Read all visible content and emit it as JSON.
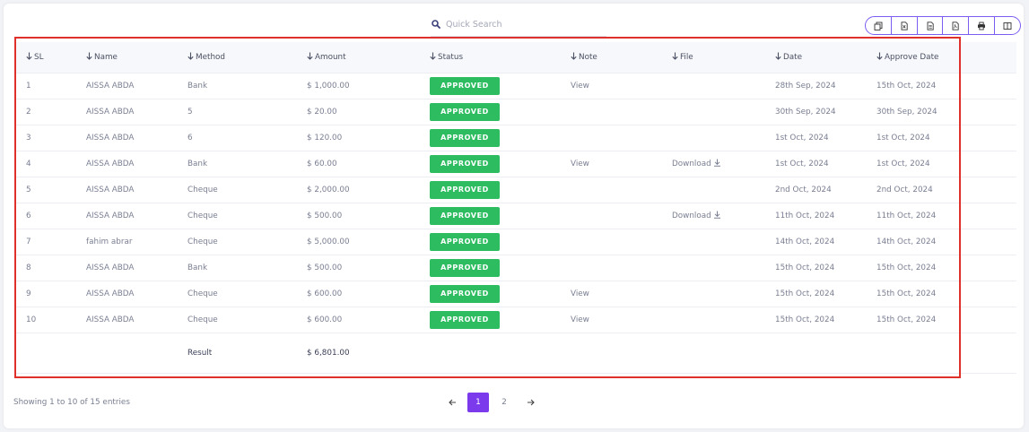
{
  "search": {
    "placeholder": "Quick Search",
    "icon": "search-icon"
  },
  "toolbar": {
    "buttons": [
      "copy-icon",
      "excel-icon",
      "csv-icon",
      "pdf-icon",
      "print-icon",
      "columns-icon"
    ],
    "accent": "#7c5cf2"
  },
  "table": {
    "headers": {
      "sl": "SL",
      "name": "Name",
      "method": "Method",
      "amount": "Amount",
      "status": "Status",
      "note": "Note",
      "file": "File",
      "date": "Date",
      "approve_date": "Approve Date"
    },
    "rows": [
      {
        "sl": "1",
        "name": "AISSA ABDA",
        "method": "Bank",
        "amount": "$ 1,000.00",
        "status": "APPROVED",
        "note": "View",
        "file": "",
        "date": "28th Sep, 2024",
        "approve_date": "15th Oct, 2024"
      },
      {
        "sl": "2",
        "name": "AISSA ABDA",
        "method": "5",
        "amount": "$ 20.00",
        "status": "APPROVED",
        "note": "",
        "file": "",
        "date": "30th Sep, 2024",
        "approve_date": "30th Sep, 2024"
      },
      {
        "sl": "3",
        "name": "AISSA ABDA",
        "method": "6",
        "amount": "$ 120.00",
        "status": "APPROVED",
        "note": "",
        "file": "",
        "date": "1st Oct, 2024",
        "approve_date": "1st Oct, 2024"
      },
      {
        "sl": "4",
        "name": "AISSA ABDA",
        "method": "Bank",
        "amount": "$ 60.00",
        "status": "APPROVED",
        "note": "View",
        "file": "Download",
        "date": "1st Oct, 2024",
        "approve_date": "1st Oct, 2024"
      },
      {
        "sl": "5",
        "name": "AISSA ABDA",
        "method": "Cheque",
        "amount": "$ 2,000.00",
        "status": "APPROVED",
        "note": "",
        "file": "",
        "date": "2nd Oct, 2024",
        "approve_date": "2nd Oct, 2024"
      },
      {
        "sl": "6",
        "name": "AISSA ABDA",
        "method": "Cheque",
        "amount": "$ 500.00",
        "status": "APPROVED",
        "note": "",
        "file": "Download",
        "date": "11th Oct, 2024",
        "approve_date": "11th Oct, 2024"
      },
      {
        "sl": "7",
        "name": "fahim abrar",
        "method": "Cheque",
        "amount": "$ 5,000.00",
        "status": "APPROVED",
        "note": "",
        "file": "",
        "date": "14th Oct, 2024",
        "approve_date": "14th Oct, 2024"
      },
      {
        "sl": "8",
        "name": "AISSA ABDA",
        "method": "Bank",
        "amount": "$ 500.00",
        "status": "APPROVED",
        "note": "",
        "file": "",
        "date": "15th Oct, 2024",
        "approve_date": "15th Oct, 2024"
      },
      {
        "sl": "9",
        "name": "AISSA ABDA",
        "method": "Cheque",
        "amount": "$ 600.00",
        "status": "APPROVED",
        "note": "View",
        "file": "",
        "date": "15th Oct, 2024",
        "approve_date": "15th Oct, 2024"
      },
      {
        "sl": "10",
        "name": "AISSA ABDA",
        "method": "Cheque",
        "amount": "$ 600.00",
        "status": "APPROVED",
        "note": "View",
        "file": "",
        "date": "15th Oct, 2024",
        "approve_date": "15th Oct, 2024"
      }
    ],
    "result": {
      "label": "Result",
      "amount": "$ 6,801.00"
    },
    "status_color": "#2ebc61"
  },
  "footer": {
    "info": "Showing 1 to 10 of 15 entries",
    "pages": [
      "1",
      "2"
    ],
    "active_page": "1",
    "active_color": "#7c3aed"
  },
  "highlight_color": "#e0302b"
}
